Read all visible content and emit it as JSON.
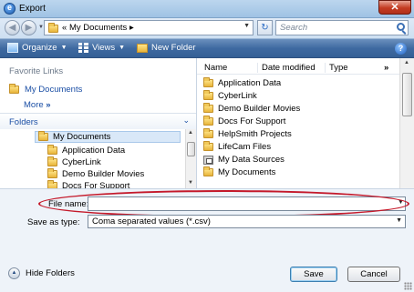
{
  "window": {
    "title": "Export",
    "close_label": "✕"
  },
  "address": {
    "path_prefix": "«",
    "path": "My Documents",
    "path_arrow": "▸",
    "search_placeholder": "Search"
  },
  "toolbar": {
    "organize": "Organize",
    "views": "Views",
    "new_folder": "New Folder",
    "help": "?"
  },
  "left": {
    "favorite_links_title": "Favorite Links",
    "favorites": [
      "My Documents"
    ],
    "more": "More",
    "more_chevron": "»",
    "folders_label": "Folders",
    "folders_chevron": "⌄",
    "tree": [
      {
        "label": "My Documents",
        "selected": true
      },
      {
        "label": "Application Data"
      },
      {
        "label": "CyberLink"
      },
      {
        "label": "Demo Builder Movies"
      },
      {
        "label": "Docs For Support"
      }
    ]
  },
  "right": {
    "columns": {
      "name": "Name",
      "date": "Date modified",
      "type": "Type",
      "more": "»"
    },
    "files": [
      {
        "label": "Application Data",
        "icon": "folder-icon"
      },
      {
        "label": "CyberLink",
        "icon": "folder-icon"
      },
      {
        "label": "Demo Builder Movies",
        "icon": "folder-icon"
      },
      {
        "label": "Docs For Support",
        "icon": "folder-icon"
      },
      {
        "label": "HelpSmith Projects",
        "icon": "folder-icon"
      },
      {
        "label": "LifeCam Files",
        "icon": "folder-icon"
      },
      {
        "label": "My Data Sources",
        "icon": "data-source-icon"
      },
      {
        "label": "My Documents",
        "icon": "folder-icon"
      }
    ]
  },
  "form": {
    "file_name_label": "File name:",
    "file_name_value": "",
    "save_as_type_label": "Save as type:",
    "save_as_type_value": "Coma separated values (*.csv)",
    "hide_folders": "Hide Folders",
    "save": "Save",
    "cancel": "Cancel"
  },
  "colors": {
    "highlight_oval": "#c4192a",
    "toolbar": "#3f6aa1",
    "link": "#1b4fa5"
  }
}
